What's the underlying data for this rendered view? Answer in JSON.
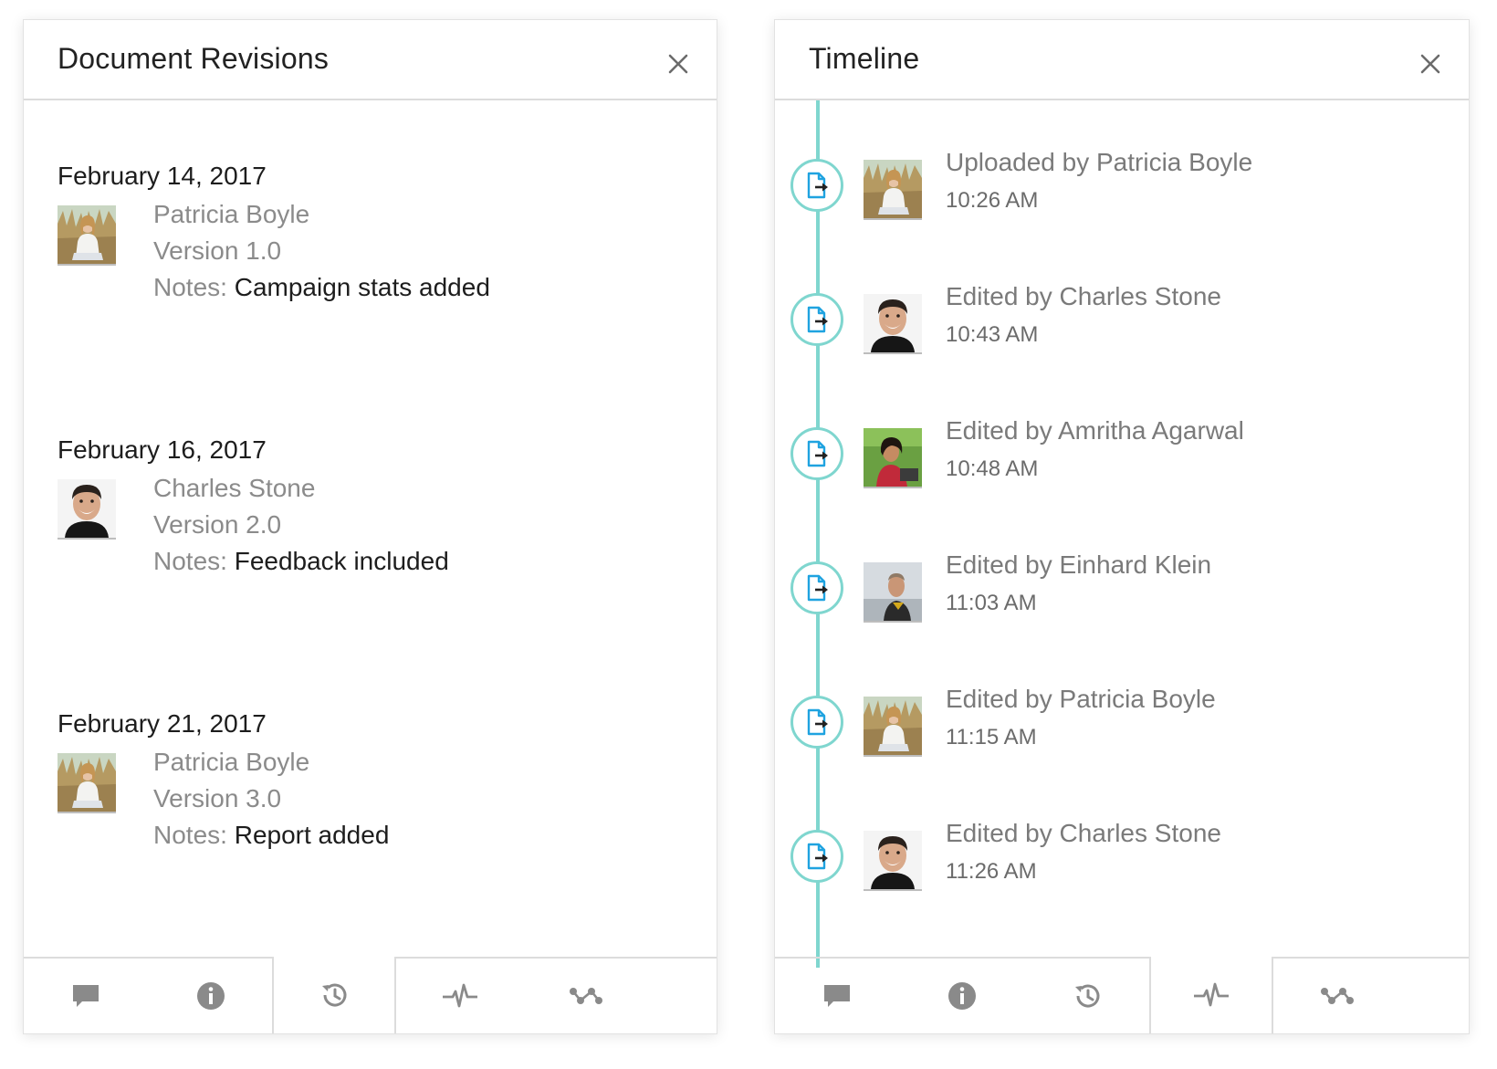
{
  "revisions_panel": {
    "title": "Document Revisions",
    "close_icon": "close-icon",
    "notes_label": "Notes:",
    "entries": [
      {
        "date": "February 14, 2017",
        "author": "Patricia Boyle",
        "version": "Version 1.0",
        "notes": "Campaign stats added",
        "avatar": "patricia-boyle-avatar"
      },
      {
        "date": "February 16, 2017",
        "author": "Charles Stone",
        "version": "Version 2.0",
        "notes": "Feedback included",
        "avatar": "charles-stone-avatar"
      },
      {
        "date": "February 21, 2017",
        "author": "Patricia Boyle",
        "version": "Version 3.0",
        "notes": "Report added",
        "avatar": "patricia-boyle-avatar"
      }
    ],
    "toolbar": {
      "icons": [
        "comment-icon",
        "info-icon",
        "history-icon",
        "activity-icon",
        "workflow-icon"
      ],
      "active": "history-icon"
    }
  },
  "timeline_panel": {
    "title": "Timeline",
    "close_icon": "close-icon",
    "events": [
      {
        "text": "Uploaded by Patricia Boyle",
        "time": "10:26 AM",
        "avatar": "patricia-boyle-avatar"
      },
      {
        "text": "Edited by Charles Stone",
        "time": "10:43 AM",
        "avatar": "charles-stone-avatar"
      },
      {
        "text": "Edited by Amritha Agarwal",
        "time": "10:48 AM",
        "avatar": "amritha-agarwal-avatar"
      },
      {
        "text": "Edited by Einhard Klein",
        "time": "11:03 AM",
        "avatar": "einhard-klein-avatar"
      },
      {
        "text": "Edited by Patricia Boyle",
        "time": "11:15 AM",
        "avatar": "patricia-boyle-avatar"
      },
      {
        "text": "Edited by Charles Stone",
        "time": "11:26 AM",
        "avatar": "charles-stone-avatar"
      }
    ],
    "toolbar": {
      "icons": [
        "comment-icon",
        "info-icon",
        "history-icon",
        "activity-icon",
        "workflow-icon"
      ],
      "active": "activity-icon"
    }
  },
  "colors": {
    "timeline_accent": "#7fd6cf",
    "doc_icon_blue": "#1fa3e0",
    "toolbar_icon": "#8a8a8a"
  }
}
